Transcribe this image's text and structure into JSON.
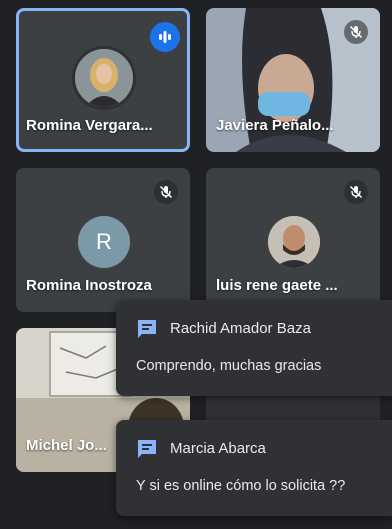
{
  "participants": [
    {
      "name": "Romina Vergara...",
      "state": "speaking",
      "avatar": "photo"
    },
    {
      "name": "Javiera Peñalo...",
      "state": "muted",
      "avatar": "video"
    },
    {
      "name": "Romina Inostroza",
      "state": "muted",
      "avatar": "letter",
      "initial": "R"
    },
    {
      "name": "luis rene gaete ...",
      "state": "muted",
      "avatar": "photo"
    },
    {
      "name": "Michel Jo...",
      "state": "",
      "avatar": "video"
    }
  ],
  "notifications": [
    {
      "sender": "Rachid Amador Baza",
      "message": "Comprendo, muchas gracias",
      "icon": "chat-icon"
    },
    {
      "sender": "Marcia Abarca",
      "message": "Y si es online cómo lo solicita ??",
      "icon": "chat-icon"
    }
  ],
  "colors": {
    "background": "#202124",
    "tile": "#3c4043",
    "active_outline": "#8ab4f8",
    "speaking": "#1a73e8",
    "chat_icon": "#8ab4f8",
    "avatar_letter_bg": "#7b9aa8"
  }
}
